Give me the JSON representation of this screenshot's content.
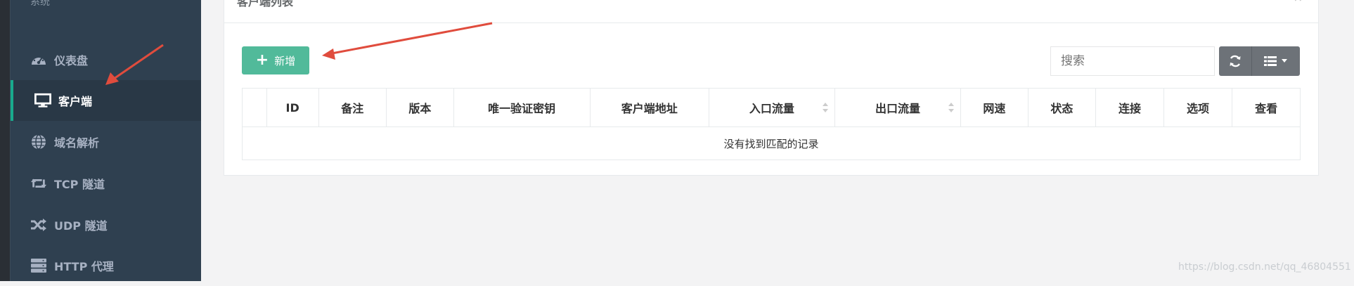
{
  "sidebar": {
    "top_label": "系统",
    "items": [
      {
        "label": "仪表盘",
        "icon": "dashboard-icon",
        "active": false
      },
      {
        "label": "客户端",
        "icon": "monitor-icon",
        "active": true
      },
      {
        "label": "域名解析",
        "icon": "globe-icon",
        "active": false
      },
      {
        "label": "TCP 隧道",
        "icon": "retweet-icon",
        "active": false
      },
      {
        "label": "UDP 隧道",
        "icon": "random-icon",
        "active": false
      },
      {
        "label": "HTTP 代理",
        "icon": "server-icon",
        "active": false
      }
    ]
  },
  "panel": {
    "title": "客户端列表",
    "tools": "^ ×"
  },
  "toolbar": {
    "add_label": "新增",
    "search_placeholder": "搜索"
  },
  "table": {
    "columns": [
      "ID",
      "备注",
      "版本",
      "唯一验证密钥",
      "客户端地址",
      "入口流量",
      "出口流量",
      "网速",
      "状态",
      "连接",
      "选项",
      "查看"
    ],
    "empty_text": "没有找到匹配的记录"
  },
  "watermark": "https://blog.csdn.net/qq_46804551",
  "colors": {
    "sidebar_bg": "#2f4050",
    "accent": "#19aa8d",
    "add_button": "#51ba9a",
    "annotation_arrow": "#e04c3d"
  }
}
